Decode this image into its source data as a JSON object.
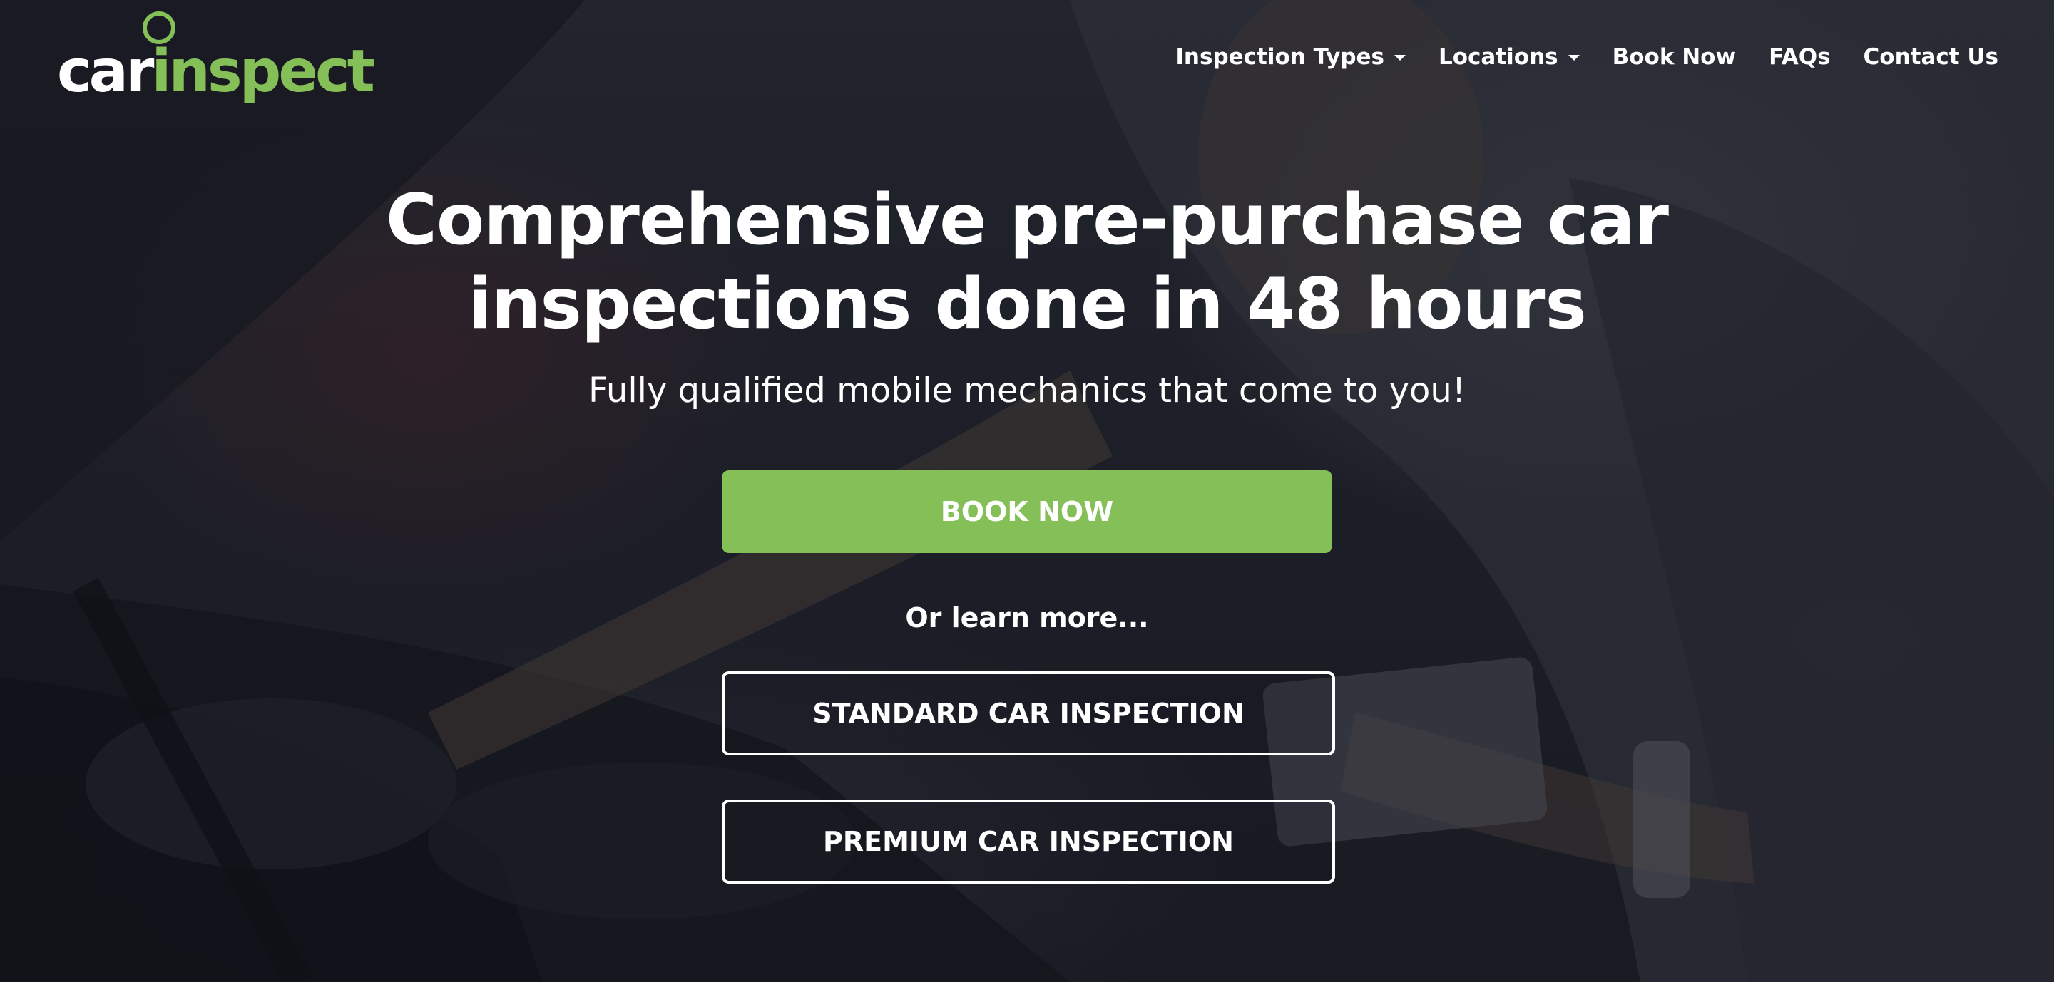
{
  "brand": {
    "logo_text_part1": "car",
    "logo_text_part2": "inspect",
    "accent_color": "#84bf58"
  },
  "nav": {
    "items": [
      {
        "label": "Inspection Types",
        "has_dropdown": true
      },
      {
        "label": "Locations",
        "has_dropdown": true
      },
      {
        "label": "Book Now",
        "has_dropdown": false
      },
      {
        "label": "FAQs",
        "has_dropdown": false
      },
      {
        "label": "Contact Us",
        "has_dropdown": false
      }
    ]
  },
  "hero": {
    "headline_line1": "Comprehensive pre-purchase car",
    "headline_line2": "inspections done in 48 hours",
    "subheadline": "Fully qualified mobile mechanics that come to you!",
    "primary_button": "BOOK NOW",
    "learn_more": "Or learn more...",
    "standard_button": "STANDARD CAR INSPECTION",
    "premium_button": "PREMIUM CAR INSPECTION"
  }
}
